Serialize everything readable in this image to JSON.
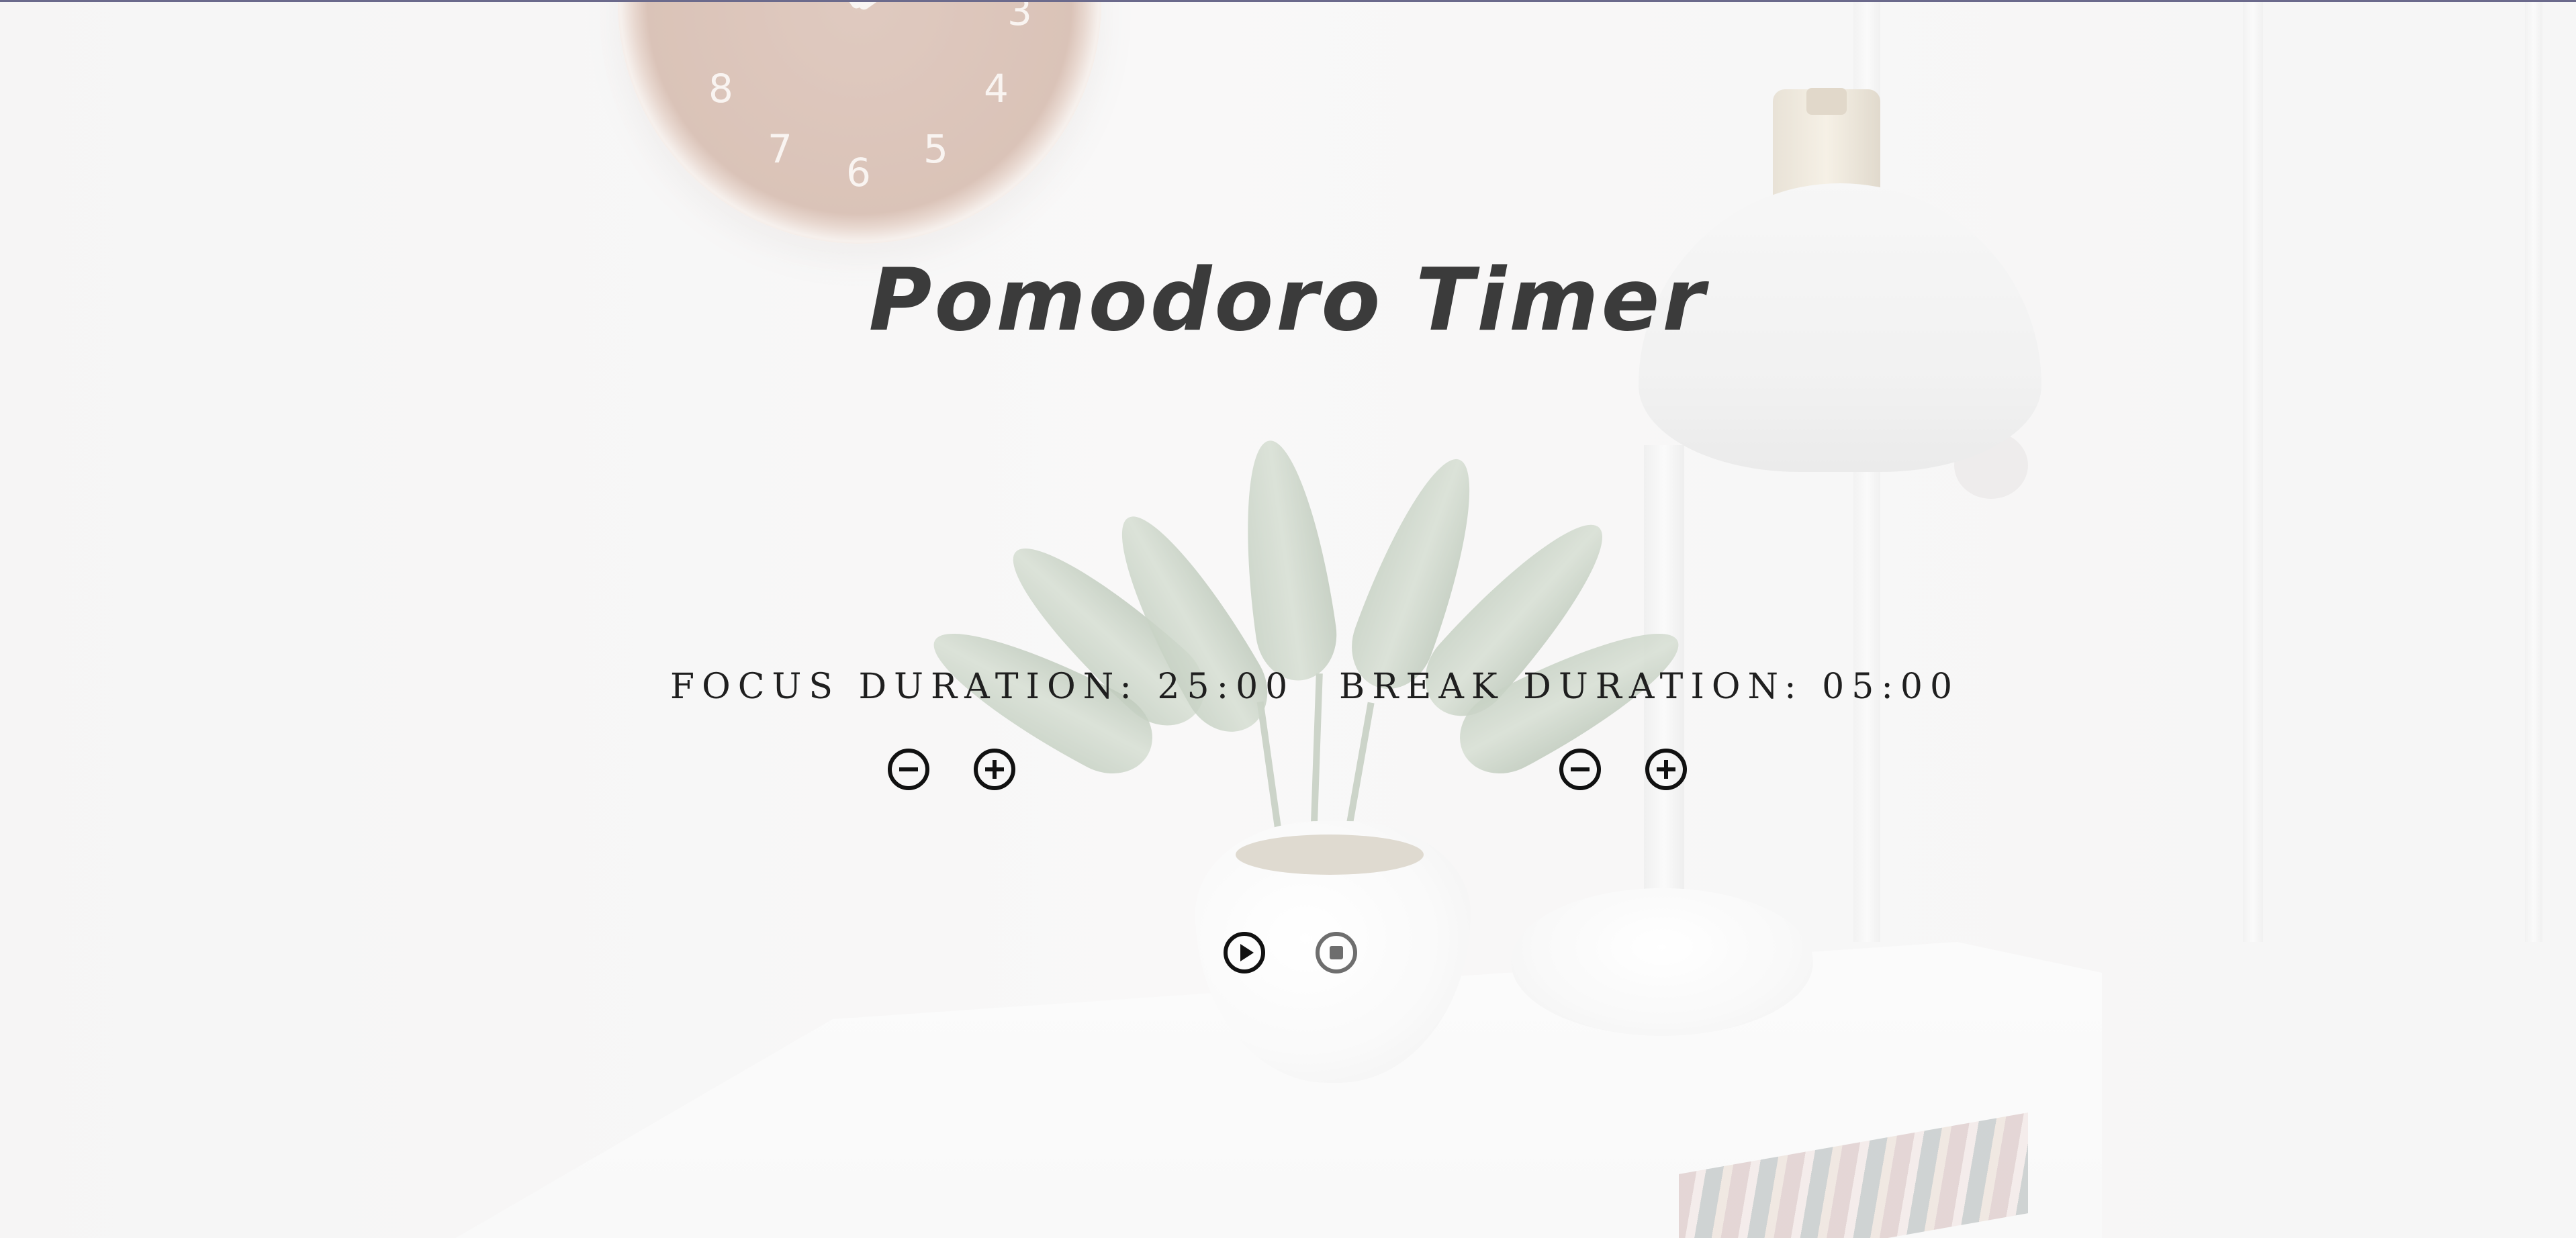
{
  "app": {
    "title": "Pomodoro Timer"
  },
  "focus": {
    "label": "FOCUS DURATION: 25:00",
    "decrease_icon": "minus-circle-icon",
    "increase_icon": "plus-circle-icon"
  },
  "break": {
    "label": "BREAK DURATION: 05:00",
    "decrease_icon": "minus-circle-icon",
    "increase_icon": "plus-circle-icon"
  },
  "controls": {
    "play_icon": "play-circle-icon",
    "stop_icon": "stop-circle-icon"
  },
  "background": {
    "clock_numbers": [
      "8",
      "7",
      "6",
      "5",
      "4",
      "3"
    ]
  },
  "colors": {
    "title": "#3b3b3b",
    "label": "#1f1f1f",
    "icon_active": "#111111",
    "icon_disabled": "#6e6e6e",
    "top_border": "#6b6a8c"
  }
}
